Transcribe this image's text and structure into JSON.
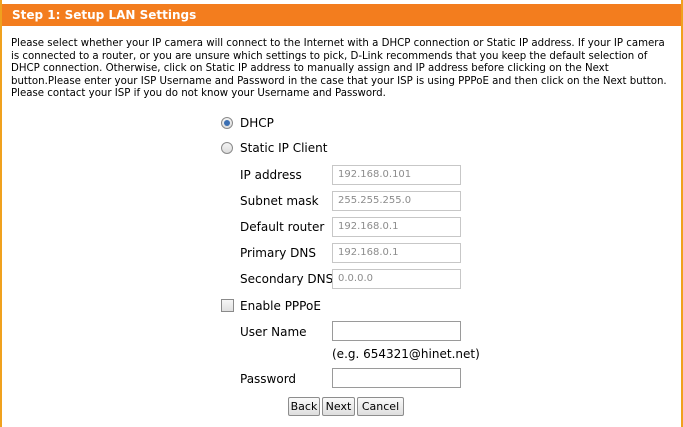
{
  "header": {
    "title": "Step 1: Setup LAN Settings"
  },
  "description": "Please select whether your IP camera will connect to the Internet with a DHCP connection or Static IP address. If your IP camera is connected to a router, or you are unsure which settings to pick, D-Link recommends that you keep the default selection of DHCP connection. Otherwise, click on Static IP address to manually assign and IP address before clicking on the Next button.Please enter your ISP Username and Password in the case that your ISP is using PPPoE and then click on the Next button. Please contact your ISP if you do not know your Username and Password.",
  "connection": {
    "dhcp_label": "DHCP",
    "dhcp_selected": true,
    "static_label": "Static IP Client",
    "static_selected": false
  },
  "static_ip": {
    "ip_address": {
      "label": "IP address",
      "value": "192.168.0.101"
    },
    "subnet_mask": {
      "label": "Subnet mask",
      "value": "255.255.255.0"
    },
    "default_router": {
      "label": "Default router",
      "value": "192.168.0.1"
    },
    "primary_dns": {
      "label": "Primary DNS",
      "value": "192.168.0.1"
    },
    "secondary_dns": {
      "label": "Secondary DNS",
      "value": "0.0.0.0"
    }
  },
  "pppoe": {
    "enable_label": "Enable PPPoE",
    "enabled": false,
    "username_label": "User Name",
    "username_value": "",
    "username_hint": "(e.g. 654321@hinet.net)",
    "password_label": "Password",
    "password_value": ""
  },
  "buttons": {
    "back": "Back",
    "next": "Next",
    "cancel": "Cancel"
  },
  "colors": {
    "header_bg": "#f37d1e",
    "border": "#f0a11e",
    "radio_selected": "#3b6fb3"
  }
}
